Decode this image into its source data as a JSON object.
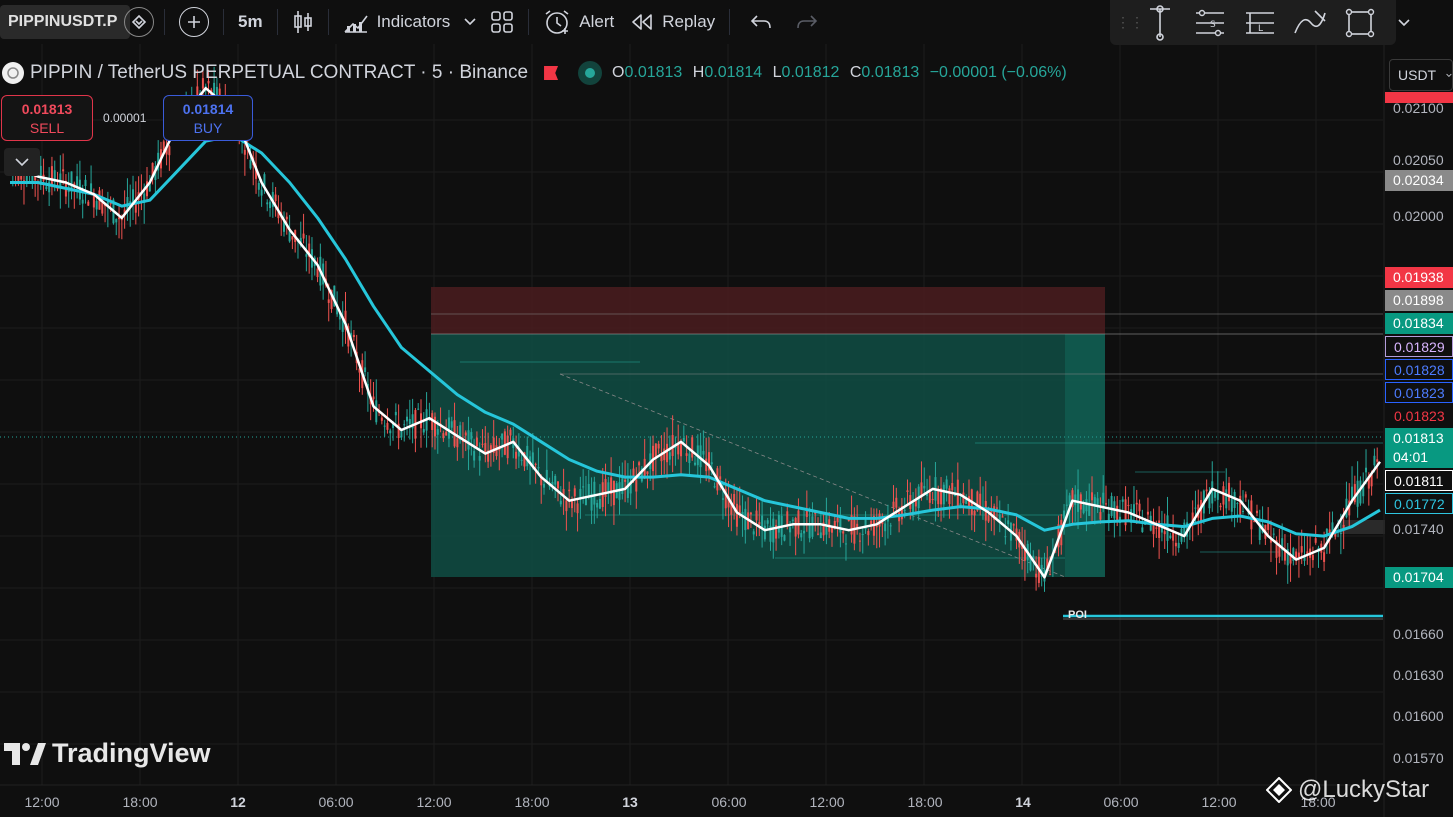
{
  "toolbar": {
    "symbol": "PIPPINUSDT.P",
    "interval": "5m",
    "indicators_label": "Indicators",
    "alert_label": "Alert",
    "replay_label": "Replay"
  },
  "legend": {
    "title": "PIPPIN / TetherUS PERPETUAL CONTRACT · 5 · Binance",
    "o_label": "O",
    "o_value": "0.01813",
    "h_label": "H",
    "h_value": "0.01814",
    "l_label": "L",
    "l_value": "0.01812",
    "c_label": "C",
    "c_value": "0.01813",
    "change": "−0.00001 (−0.06%)"
  },
  "trade": {
    "sell_price": "0.01813",
    "sell_label": "SELL",
    "buy_price": "0.01814",
    "buy_label": "BUY",
    "spread": "0.00001"
  },
  "currency": "USDT",
  "price_ticks": [
    "0.02100",
    "0.02050",
    "0.02000",
    "0.01740",
    "0.01660",
    "0.01630",
    "0.01600",
    "0.01570"
  ],
  "price_labels": [
    {
      "text": "0.01938",
      "bg": "#f23645",
      "fg": "#ffffff"
    },
    {
      "text": "0.01898",
      "bg": "#8a8a8a",
      "fg": "#ffffff"
    },
    {
      "text": "0.01834",
      "bg": "#089981",
      "fg": "#ffffff"
    },
    {
      "text": "0.01829",
      "bg": "#0f0f0f",
      "fg": "#d8b4fe",
      "border": "#b39ddb"
    },
    {
      "text": "0.01828",
      "bg": "#0f0f0f",
      "fg": "#4d7cff",
      "border": "#2962ff"
    },
    {
      "text": "0.01823",
      "bg": "#0f0f0f",
      "fg": "#4d7cff",
      "border": "#2962ff"
    },
    {
      "text": "0.01823",
      "bg": "#0f0f0f",
      "fg": "#f23645",
      "border": "#0f0f0f"
    },
    {
      "text": "0.01813",
      "bg": "#089981",
      "fg": "#ffffff"
    },
    {
      "text": "04:01",
      "bg": "#089981",
      "fg": "#ffffff"
    },
    {
      "text": "0.01811",
      "bg": "#0f0f0f",
      "fg": "#ffffff",
      "border": "#ffffff"
    },
    {
      "text": "0.01772",
      "bg": "#0f0f0f",
      "fg": "#2ec5e0",
      "border": "#2ec5e0"
    },
    {
      "text": "0.01704",
      "bg": "#089981",
      "fg": "#ffffff"
    },
    {
      "text": "0.02034",
      "bg": "#8a8a8a",
      "fg": "#ffffff"
    }
  ],
  "time_ticks": [
    {
      "text": "12:00",
      "bold": false
    },
    {
      "text": "18:00",
      "bold": false
    },
    {
      "text": "12",
      "bold": true
    },
    {
      "text": "06:00",
      "bold": false
    },
    {
      "text": "12:00",
      "bold": false
    },
    {
      "text": "18:00",
      "bold": false
    },
    {
      "text": "13",
      "bold": true
    },
    {
      "text": "06:00",
      "bold": false
    },
    {
      "text": "12:00",
      "bold": false
    },
    {
      "text": "18:00",
      "bold": false
    },
    {
      "text": "14",
      "bold": true
    },
    {
      "text": "06:00",
      "bold": false
    },
    {
      "text": "12:00",
      "bold": false
    },
    {
      "text": "18:00",
      "bold": false
    }
  ],
  "annotations": {
    "poi": "POI"
  },
  "branding": {
    "logo_text": "TradingView",
    "watermark": "@LuckyStar"
  },
  "colors": {
    "up": "#26a69a",
    "down": "#ef5350",
    "ema_fast": "#ffffff",
    "ema_slow": "#26c6da",
    "profit_zone": "#0f4d44",
    "loss_zone": "#4a1c1f"
  },
  "chart_data": {
    "type": "line",
    "title": "",
    "series": [
      {
        "values": [
          0.02065,
          0.02055,
          0.0205,
          0.0204,
          0.0202,
          0.0205,
          0.021,
          0.0213,
          0.0211,
          0.0205,
          0.0201,
          0.0198,
          0.0193,
          0.0186,
          0.0184,
          0.0185,
          0.01835,
          0.0182,
          0.0183,
          0.018,
          0.0178,
          0.01785,
          0.0179,
          0.01815,
          0.0183,
          0.0181,
          0.0177,
          0.01755,
          0.0176,
          0.0176,
          0.01755,
          0.0176,
          0.01775,
          0.0179,
          0.01785,
          0.0177,
          0.0175,
          0.01715,
          0.0178,
          0.01775,
          0.0177,
          0.0176,
          0.0175,
          0.0179,
          0.0178,
          0.0175,
          0.0173,
          0.0174,
          0.0178,
          0.01813
        ]
      },
      {
        "values": [
          0.0205,
          0.0205,
          0.02045,
          0.0204,
          0.0203,
          0.02035,
          0.0206,
          0.02085,
          0.0209,
          0.02075,
          0.0205,
          0.0202,
          0.01985,
          0.01945,
          0.0191,
          0.0189,
          0.0187,
          0.01855,
          0.01845,
          0.0183,
          0.01815,
          0.01805,
          0.018,
          0.018,
          0.01802,
          0.018,
          0.0179,
          0.0178,
          0.01775,
          0.0177,
          0.01765,
          0.01765,
          0.01768,
          0.01772,
          0.01775,
          0.01773,
          0.01768,
          0.01755,
          0.0176,
          0.01762,
          0.01763,
          0.0176,
          0.01758,
          0.01765,
          0.01767,
          0.01762,
          0.01752,
          0.0175,
          0.01758,
          0.01772
        ]
      }
    ],
    "ylim": [
      0.0156,
      0.0212
    ]
  }
}
